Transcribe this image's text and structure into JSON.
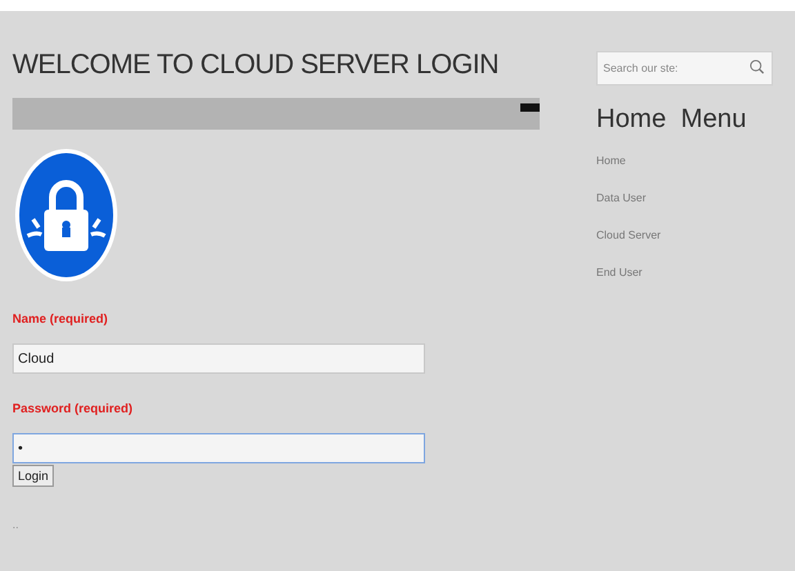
{
  "page": {
    "title": "WELCOME TO CLOUD SERVER LOGIN"
  },
  "form": {
    "fields": [
      {
        "label": "Name (required)",
        "value": "Cloud",
        "focused": false
      },
      {
        "label": "Password (required)",
        "value": "•",
        "focused": true
      }
    ],
    "button": "Login",
    "footer": ".."
  },
  "sidebar": {
    "search": {
      "placeholder": "Search our ste:"
    },
    "heading": "Home  Menu",
    "items": [
      {
        "label": "Home"
      },
      {
        "label": "Data User"
      },
      {
        "label": "Cloud Server"
      },
      {
        "label": "End User"
      }
    ]
  }
}
